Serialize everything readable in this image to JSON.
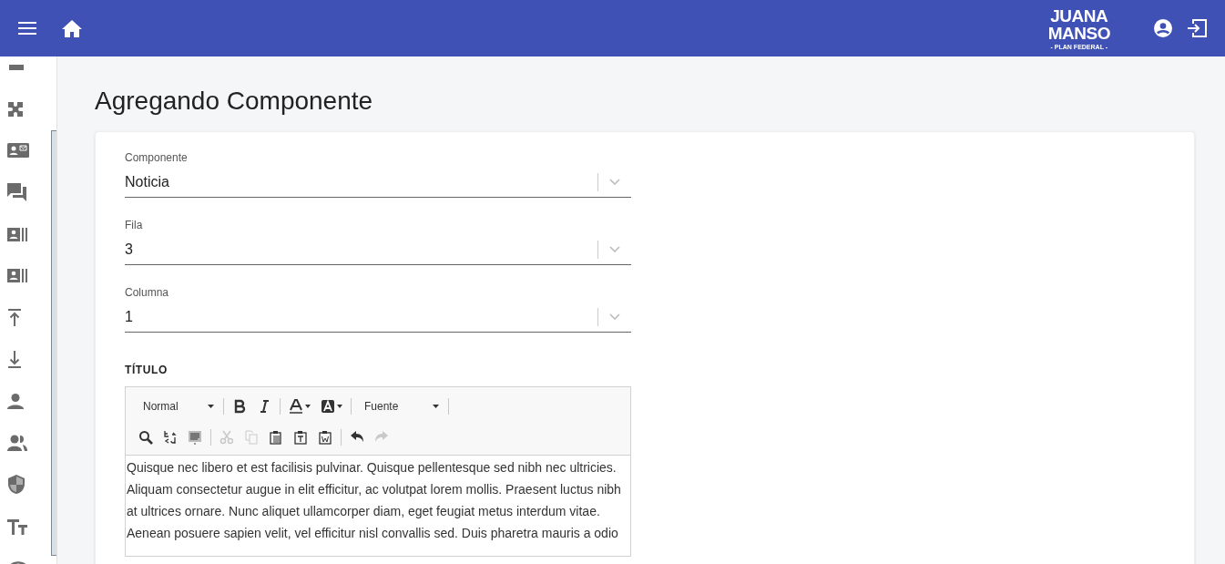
{
  "header": {
    "logo": {
      "line_1": "JUANA",
      "line_2": "MANSO",
      "line_3": "- PLAN FEDERAL -"
    }
  },
  "page": {
    "title": "Agregando Componente"
  },
  "form": {
    "selects": [
      {
        "label": "Componente",
        "value": "Noticia"
      },
      {
        "label": "Fila",
        "value": "3"
      },
      {
        "label": "Columna",
        "value": "1"
      }
    ],
    "editor": {
      "label": "TÍTULO",
      "toolbar_rows": [
        [
          {
            "kind": "dropdown",
            "text": "Normal"
          },
          {
            "kind": "separator"
          },
          {
            "kind": "button",
            "disabled": false
          },
          {
            "kind": "button",
            "disabled": false
          },
          {
            "kind": "separator"
          },
          {
            "kind": "button",
            "disabled": false
          },
          {
            "kind": "button",
            "disabled": false
          },
          {
            "kind": "separator"
          },
          {
            "kind": "dropdown",
            "text": "Fuente"
          },
          {
            "kind": "separator"
          }
        ],
        [
          {
            "kind": "button",
            "disabled": false
          },
          {
            "kind": "button",
            "disabled": false
          },
          {
            "kind": "button",
            "disabled": false
          },
          {
            "kind": "separator"
          },
          {
            "kind": "button",
            "disabled": true
          },
          {
            "kind": "button",
            "disabled": true
          },
          {
            "kind": "button",
            "disabled": false
          },
          {
            "kind": "button",
            "disabled": false
          },
          {
            "kind": "button",
            "disabled": false
          },
          {
            "kind": "separator"
          },
          {
            "kind": "button",
            "disabled": false
          },
          {
            "kind": "button",
            "disabled": true
          }
        ]
      ],
      "content": "Quisque nec libero et est facilisis pulvinar. Quisque pellentesque sed nibh nec ultricies. Aliquam consectetur augue in elit efficitur, ac volutpat lorem mollis. Praesent luctus nibh at ultrices ornare. Nunc aliquet ullamcorper diam, eget feugiat metus interdum vitae. Aenean posuere sapien velit, vel efficitur nisl convallis sed. Duis pharetra mauris a odio"
    }
  }
}
